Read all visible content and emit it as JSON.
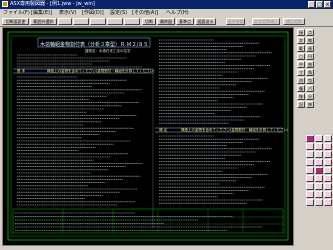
{
  "titlebar": {
    "title": "ASX専用製図器 - [例1.jww - jw_win]",
    "min": "_",
    "max": "□",
    "close": "×"
  },
  "menu": [
    "ファイル(F)",
    "[編集(E)]",
    "表示(V)",
    "[作図(D)]",
    "設定(S)",
    "[その他(A)]",
    "ヘルプ(H)"
  ],
  "toolbar": {
    "left": [
      "切断図変更",
      "範囲外選択"
    ],
    "mid": [
      "切断",
      "最終図",
      "基準点",
      "図面送る"
    ],
    "disabled": [
      "図形移動",
      "文字定数補正",
      "補正定数"
    ]
  },
  "drawing": {
    "title": "木造軸組金物割付表（分析３章型）Ｒ.Ｍ２/８５",
    "subtitle": "建物名：木造在来工法の住宅",
    "section1": "基 本",
    "section1_note": "構造上の金物を含めてください(金物割付・軸組を計算してください)",
    "section2": "補 足",
    "section2_note": "構造上の金物を含めてください(金物割付・軸組を計算してください)"
  },
  "right_panel": {
    "col1": [
      "接続",
      "文字",
      "範囲",
      "□",
      "中心",
      "寸法",
      "消去",
      "複写",
      "移動",
      "記変"
    ],
    "col2": [
      "点",
      "線",
      "連線",
      "円",
      "曲線",
      "角",
      "包絡",
      "パラ",
      "分割",
      "伸縮"
    ]
  },
  "colors": {
    "titlebar": "#0a246a",
    "canvas": "#000000",
    "frame": "#00c000",
    "text": "#d8e8f0"
  }
}
